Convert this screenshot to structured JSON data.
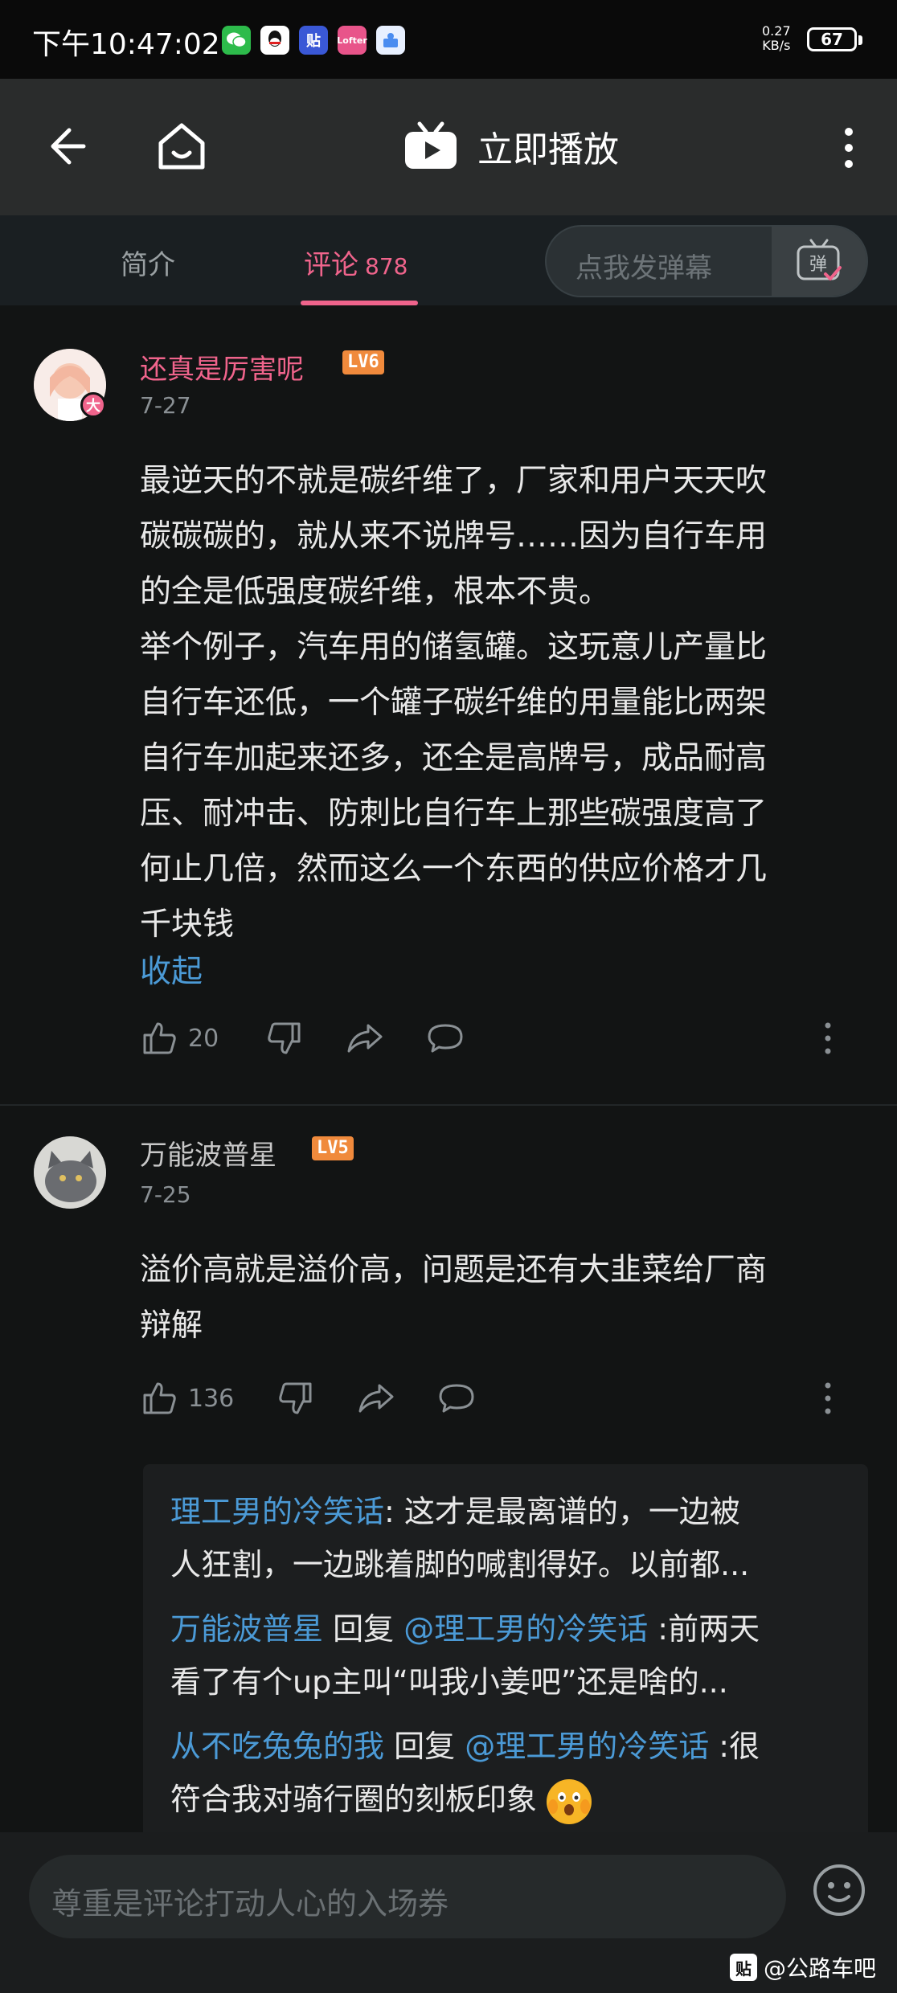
{
  "status_bar": {
    "time": "下午10:47:02",
    "net_speed_value": "0.27",
    "net_speed_unit": "KB/s",
    "battery": "67",
    "apps": [
      {
        "icon": "wechat-icon",
        "color": "#2dbb4b",
        "label": ""
      },
      {
        "icon": "qq-icon",
        "color": "#ffffff",
        "label": ""
      },
      {
        "icon": "tieba-icon",
        "color": "#3a58d6",
        "label": "贴"
      },
      {
        "icon": "lofter-icon",
        "color": "#e8548a",
        "label": "Lofter"
      },
      {
        "icon": "app-icon",
        "color": "#4a8cf0",
        "label": ""
      }
    ]
  },
  "nav": {
    "play_label": "立即播放"
  },
  "tabs": {
    "intro": "简介",
    "comments": "评论",
    "comments_count": "878",
    "danmaku_placeholder": "点我发弹幕",
    "danmaku_button": "弹"
  },
  "comments": [
    {
      "username": "还真是厉害呢",
      "username_color": "#f0648c",
      "level": "LV6",
      "vip_badge": "大",
      "date": "7-27",
      "lines": [
        "最逆天的不就是碳纤维了，厂家和用户天天吹",
        "碳碳碳的，就从来不说牌号……因为自行车用",
        "的全是低强度碳纤维，根本不贵。",
        "举个例子，汽车用的储氢罐。这玩意儿产量比",
        "自行车还低，一个罐子碳纤维的用量能比两架",
        "自行车加起来还多，还全是高牌号，成品耐高",
        "压、耐冲击、防刺比自行车上那些碳强度高了",
        "何止几倍，然而这么一个东西的供应价格才几",
        "千块钱"
      ],
      "collapse_label": "收起",
      "likes": "20"
    },
    {
      "username": "万能波普星",
      "username_color": "#c8c8c8",
      "level": "LV5",
      "date": "7-25",
      "lines": [
        "溢价高就是溢价高，问题是还有大韭菜给厂商",
        "辩解"
      ],
      "likes": "136",
      "replies": [
        {
          "user": "理工男的冷笑话",
          "reply_word": "",
          "target": "",
          "line1": ": 这才是最离谱的，一边被",
          "line2": "人狂割，一边跳着脚的喊割得好。以前都..."
        },
        {
          "user": "万能波普星",
          "reply_word": " 回复 ",
          "target": "@理工男的冷笑话",
          "line1": " :前两天",
          "line2": "看了有个up主叫“叫我小姜吧”还是啥的..."
        },
        {
          "user": "从不吃兔兔的我",
          "reply_word": " 回复 ",
          "target": "@理工男的冷笑话",
          "line1": " :很",
          "line2": "符合我对骑行圈的刻板印象"
        }
      ]
    }
  ],
  "bottom": {
    "input_placeholder": "尊重是评论打动人心的入场券",
    "watermark": "@公路车吧",
    "watermark_logo": "贴"
  }
}
